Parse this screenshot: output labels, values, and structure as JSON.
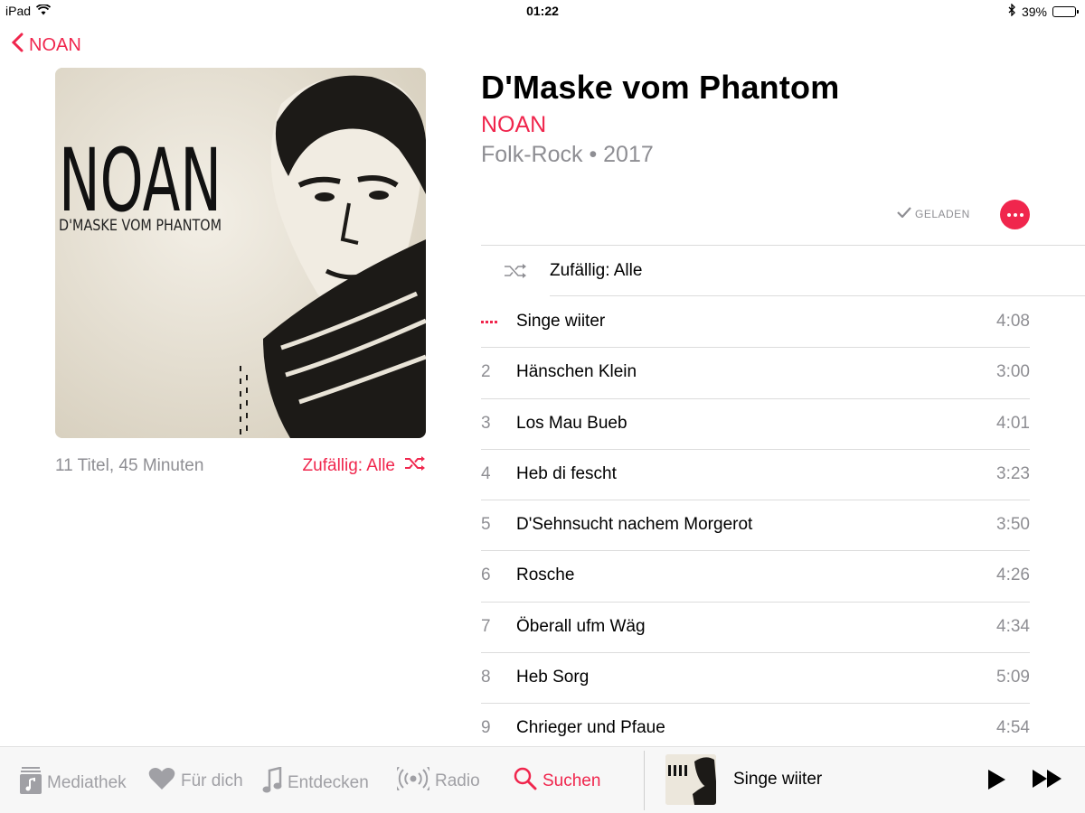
{
  "status": {
    "device": "iPad",
    "time": "01:22",
    "battery": "39%",
    "battery_level": 0.39
  },
  "nav": {
    "back_label": "NOAN"
  },
  "album": {
    "title": "D'Maske vom Phantom",
    "artist": "NOAN",
    "genre_year": "Folk-Rock • 2017",
    "summary": "11 Titel, 45 Minuten",
    "shuffle_label": "Zufällig: Alle",
    "downloaded_label": "GELADEN",
    "art_band": "NOAN",
    "art_subtitle": "D'MASKE VOM PHANTOM"
  },
  "tracklist": {
    "shuffle_label": "Zufällig: Alle",
    "tracks": [
      {
        "num": "",
        "name": "Singe wiiter",
        "duration": "4:08",
        "playing": true
      },
      {
        "num": "2",
        "name": "Hänschen Klein",
        "duration": "3:00"
      },
      {
        "num": "3",
        "name": "Los Mau Bueb",
        "duration": "4:01"
      },
      {
        "num": "4",
        "name": "Heb di fescht",
        "duration": "3:23"
      },
      {
        "num": "5",
        "name": "D'Sehnsucht nachem Morgerot",
        "duration": "3:50"
      },
      {
        "num": "6",
        "name": "Rosche",
        "duration": "4:26"
      },
      {
        "num": "7",
        "name": "Öberall ufm Wäg",
        "duration": "4:34"
      },
      {
        "num": "8",
        "name": "Heb Sorg",
        "duration": "5:09"
      },
      {
        "num": "9",
        "name": "Chrieger und Pfaue",
        "duration": "4:54"
      }
    ]
  },
  "tabbar": {
    "tabs": [
      {
        "label": "Mediathek",
        "icon": "library-icon"
      },
      {
        "label": "Für dich",
        "icon": "heart-icon"
      },
      {
        "label": "Entdecken",
        "icon": "music-note-icon"
      },
      {
        "label": "Radio",
        "icon": "radio-icon"
      },
      {
        "label": "Suchen",
        "icon": "search-icon",
        "active": true
      }
    ],
    "now_playing": {
      "title": "Singe wiiter"
    }
  },
  "colors": {
    "accent": "#f0264d",
    "secondary_text": "#8e8e93"
  }
}
